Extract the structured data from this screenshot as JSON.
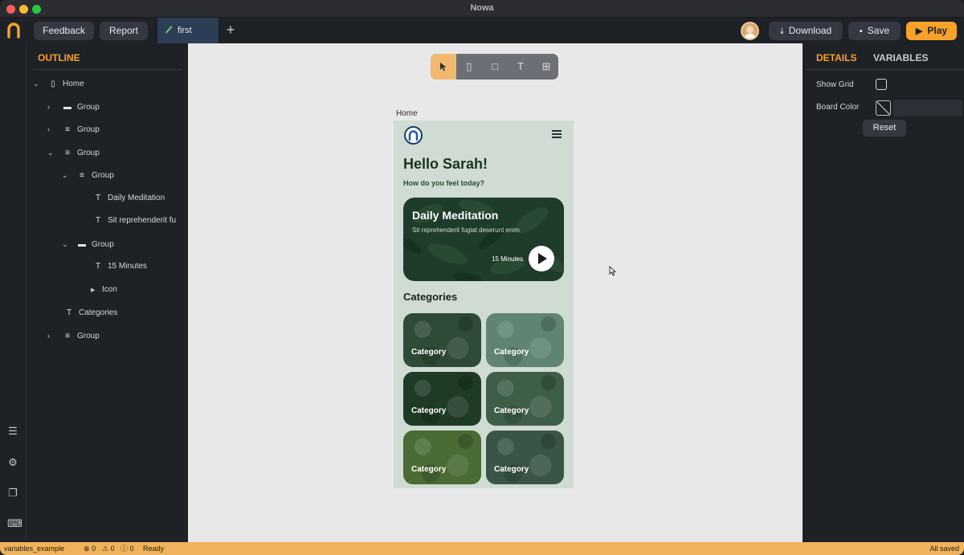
{
  "window": {
    "title": "Nowa"
  },
  "toolbar": {
    "feedback_label": "Feedback",
    "report_label": "Report",
    "tab_label": "first",
    "add_tab_label": "+",
    "download_label": "Download",
    "save_label": "Save",
    "play_label": "Play",
    "play_color": "#f7a22a"
  },
  "outline": {
    "header": "OUTLINE",
    "items": [
      {
        "label": "Home",
        "caret": "expanded",
        "icon": "phone-icon",
        "depth": 0
      },
      {
        "label": "Group",
        "caret": "collapsed",
        "icon": "box-icon",
        "depth": 1
      },
      {
        "label": "Group",
        "caret": "collapsed",
        "icon": "rows-icon",
        "depth": 1
      },
      {
        "label": "Group",
        "caret": "expanded",
        "icon": "rows-icon",
        "depth": 1
      },
      {
        "label": "Group",
        "caret": "expanded",
        "icon": "rows-icon",
        "depth": 2
      },
      {
        "label": "Daily Meditation",
        "caret": "none",
        "icon": "text-icon",
        "depth": 3
      },
      {
        "label": "Sit reprehenderit fu",
        "caret": "none",
        "icon": "text-icon",
        "depth": 3
      },
      {
        "label": "Group",
        "caret": "expanded",
        "icon": "box-icon",
        "depth": 2
      },
      {
        "label": "15 Minutes",
        "caret": "none",
        "icon": "text-icon",
        "depth": 3
      },
      {
        "label": "Icon",
        "caret": "collapsed-solid",
        "icon": "none",
        "depth": 3
      },
      {
        "label": "Categories",
        "caret": "none",
        "icon": "text-icon",
        "depth": 2
      },
      {
        "label": "Group",
        "caret": "collapsed",
        "icon": "rows-icon",
        "depth": 1
      }
    ]
  },
  "canvas": {
    "frame_label": "Home",
    "tools": [
      "select-tool-icon",
      "phone-tool-icon",
      "frame-tool-icon",
      "text-tool-icon",
      "components-tool-icon"
    ]
  },
  "phone": {
    "greeting": "Hello Sarah!",
    "question": "How do you feel today?",
    "hero_title": "Daily Meditation",
    "hero_subtitle": "Sit reprehenderit fugiat deserunt enim",
    "hero_duration": "15 Minutes",
    "categories_heading": "Categories",
    "categories": [
      {
        "label": "Category",
        "color": "#2f4a37"
      },
      {
        "label": "Category",
        "color": "#5f8572"
      },
      {
        "label": "Category",
        "color": "#1f3a25"
      },
      {
        "label": "Category",
        "color": "#3f5e48"
      },
      {
        "label": "Category",
        "color": "#4a6b33"
      },
      {
        "label": "Category",
        "color": "#3a5547"
      }
    ]
  },
  "details": {
    "tab_details": "DETAILS",
    "tab_variables": "VARIABLES",
    "show_grid_label": "Show Grid",
    "board_color_label": "Board Color",
    "reset_label": "Reset"
  },
  "status": {
    "project": "variables_example",
    "errors": "0",
    "warnings": "0",
    "infos": "0",
    "ready": "Ready",
    "saved": "All saved",
    "color": "#f0b25a"
  }
}
